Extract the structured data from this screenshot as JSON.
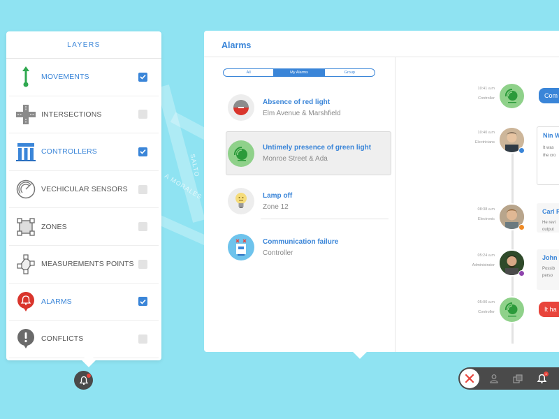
{
  "map": {
    "street_labels": [
      "SALTO",
      "A MORALES"
    ]
  },
  "layers": {
    "title": "LAYERS",
    "items": [
      {
        "label": "MOVEMENTS",
        "icon": "movement-arrow-icon",
        "active": true,
        "checked": true
      },
      {
        "label": "INTERSECTIONS",
        "icon": "intersection-icon",
        "active": false,
        "checked": false
      },
      {
        "label": "CONTROLLERS",
        "icon": "controller-icon",
        "active": true,
        "checked": true
      },
      {
        "label": "VECHICULAR SENSORS",
        "icon": "sensor-radar-icon",
        "active": false,
        "checked": false
      },
      {
        "label": "ZONES",
        "icon": "zone-square-icon",
        "active": false,
        "checked": false
      },
      {
        "label": "MEASUREMENTS POINTS",
        "icon": "measurement-points-icon",
        "active": false,
        "checked": false
      },
      {
        "label": "ALARMS",
        "icon": "alarm-bell-icon",
        "active": true,
        "checked": true
      },
      {
        "label": "CONFLICTS",
        "icon": "conflict-exclamation-icon",
        "active": false,
        "checked": false
      }
    ]
  },
  "alarms": {
    "title": "Alarms",
    "tabs": [
      {
        "label": "All",
        "active": false
      },
      {
        "label": "My Alarms",
        "active": true
      },
      {
        "label": "Group",
        "active": false
      }
    ],
    "items": [
      {
        "title": "Absence of red light",
        "subtitle": "Elm Avenue & Marshfield",
        "icon": "red-light-icon",
        "selected": false
      },
      {
        "title": "Untimely presence of green light",
        "subtitle": "Monroe Street & Ada",
        "icon": "green-signal-icon",
        "selected": true
      },
      {
        "title": "Lamp off",
        "subtitle": "Zone 12",
        "icon": "lamp-off-icon",
        "selected": false
      },
      {
        "title": "Communication failure",
        "subtitle": "Controller",
        "icon": "communication-failure-icon",
        "selected": false
      }
    ],
    "timeline": [
      {
        "time": "10:41 a.m",
        "role": "Controller",
        "kind": "controller",
        "message": "Com"
      },
      {
        "time": "10:40 a.m",
        "role": "Electricians",
        "kind": "person",
        "name": "Nin W",
        "text_lines": [
          "It was",
          "the cro"
        ],
        "status_color": "#3a85d8"
      },
      {
        "time": "08:38 a.m",
        "role": "Electronic",
        "kind": "person",
        "name": "Carl R",
        "text_lines": [
          "He revi",
          "output"
        ],
        "status_color": "#f08a24"
      },
      {
        "time": "05:24 a.m",
        "role": "Administrator",
        "kind": "person",
        "name": "John",
        "text_lines": [
          "Possib",
          "perso"
        ],
        "status_color": "#8e44ad"
      },
      {
        "time": "05:00 a.m",
        "role": "Controller",
        "kind": "controller",
        "message": "It ha"
      }
    ]
  },
  "toolbar": {
    "buttons": [
      "close-icon",
      "user-icon",
      "layers-icon",
      "bell-icon"
    ],
    "badge": "4"
  },
  "colors": {
    "accent": "#3a85d8",
    "danger": "#e8453c",
    "green": "#8fd18a",
    "background": "#8fe3f2"
  }
}
